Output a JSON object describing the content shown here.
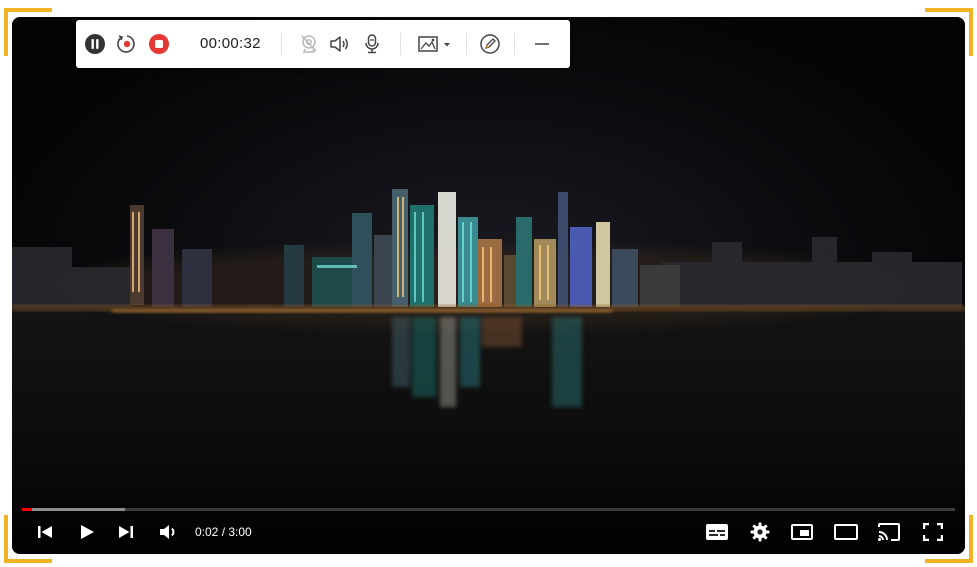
{
  "recorder": {
    "timer": "00:00:32",
    "buttons": [
      {
        "name": "pause",
        "icon": "pause-circle-icon"
      },
      {
        "name": "restart",
        "icon": "restart-record-icon"
      },
      {
        "name": "stop",
        "icon": "stop-circle-icon"
      },
      {
        "name": "webcam",
        "icon": "webcam-off-icon"
      },
      {
        "name": "system-audio",
        "icon": "speaker-icon"
      },
      {
        "name": "microphone",
        "icon": "microphone-icon"
      },
      {
        "name": "screenshot",
        "icon": "screenshot-icon"
      },
      {
        "name": "annotate",
        "icon": "pen-icon"
      },
      {
        "name": "minimize",
        "icon": "minimize-icon"
      }
    ],
    "colors": {
      "stop_red": "#e53935",
      "pause_dark": "#333333",
      "border_accent": "#f0b323"
    }
  },
  "player": {
    "current_time": "0:02",
    "duration": "3:00",
    "time_display": "0:02 / 3:00",
    "progress_played_fraction": 0.011,
    "progress_buffered_fraction": 0.11,
    "colors": {
      "progress_played": "#ff0000",
      "controls": "#ffffff"
    },
    "controls_left": [
      "previous-icon",
      "play-icon",
      "next-icon",
      "volume-icon"
    ],
    "controls_right": [
      "subtitles-icon",
      "settings-gear-icon",
      "miniplayer-icon",
      "theater-mode-icon",
      "cast-icon",
      "fullscreen-icon"
    ]
  }
}
